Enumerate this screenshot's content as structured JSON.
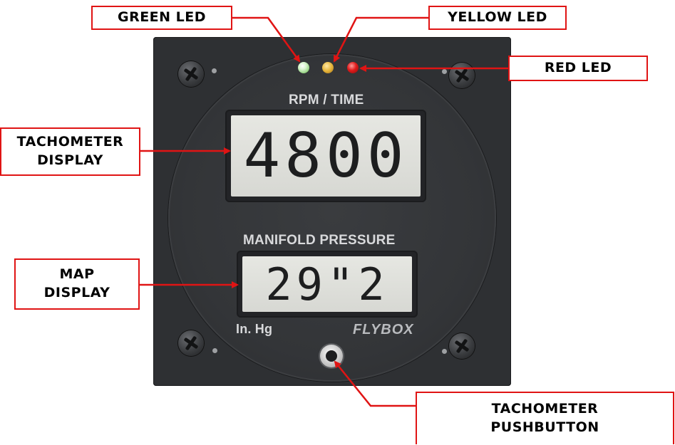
{
  "device": {
    "top_display_caption": "RPM / TIME",
    "top_display_value": "4800",
    "bottom_display_caption": "MANIFOLD PRESSURE",
    "bottom_display_value": "29\"2",
    "units_label": "In. Hg",
    "brand": "FLYBOX"
  },
  "callouts": {
    "green_led": "GREEN LED",
    "yellow_led": "YELLOW LED",
    "red_led": "RED LED",
    "tachometer_display": "TACHOMETER\nDISPLAY",
    "map_display": "MAP\nDISPLAY",
    "tachometer_pushbutton": "TACHOMETER\nPUSHBUTTON"
  },
  "colors": {
    "callout_red": "#e01414",
    "panel": "#2e3033",
    "led_green": "#8fcf7b",
    "led_yellow": "#e6b53a",
    "led_red": "#e01b1b"
  }
}
